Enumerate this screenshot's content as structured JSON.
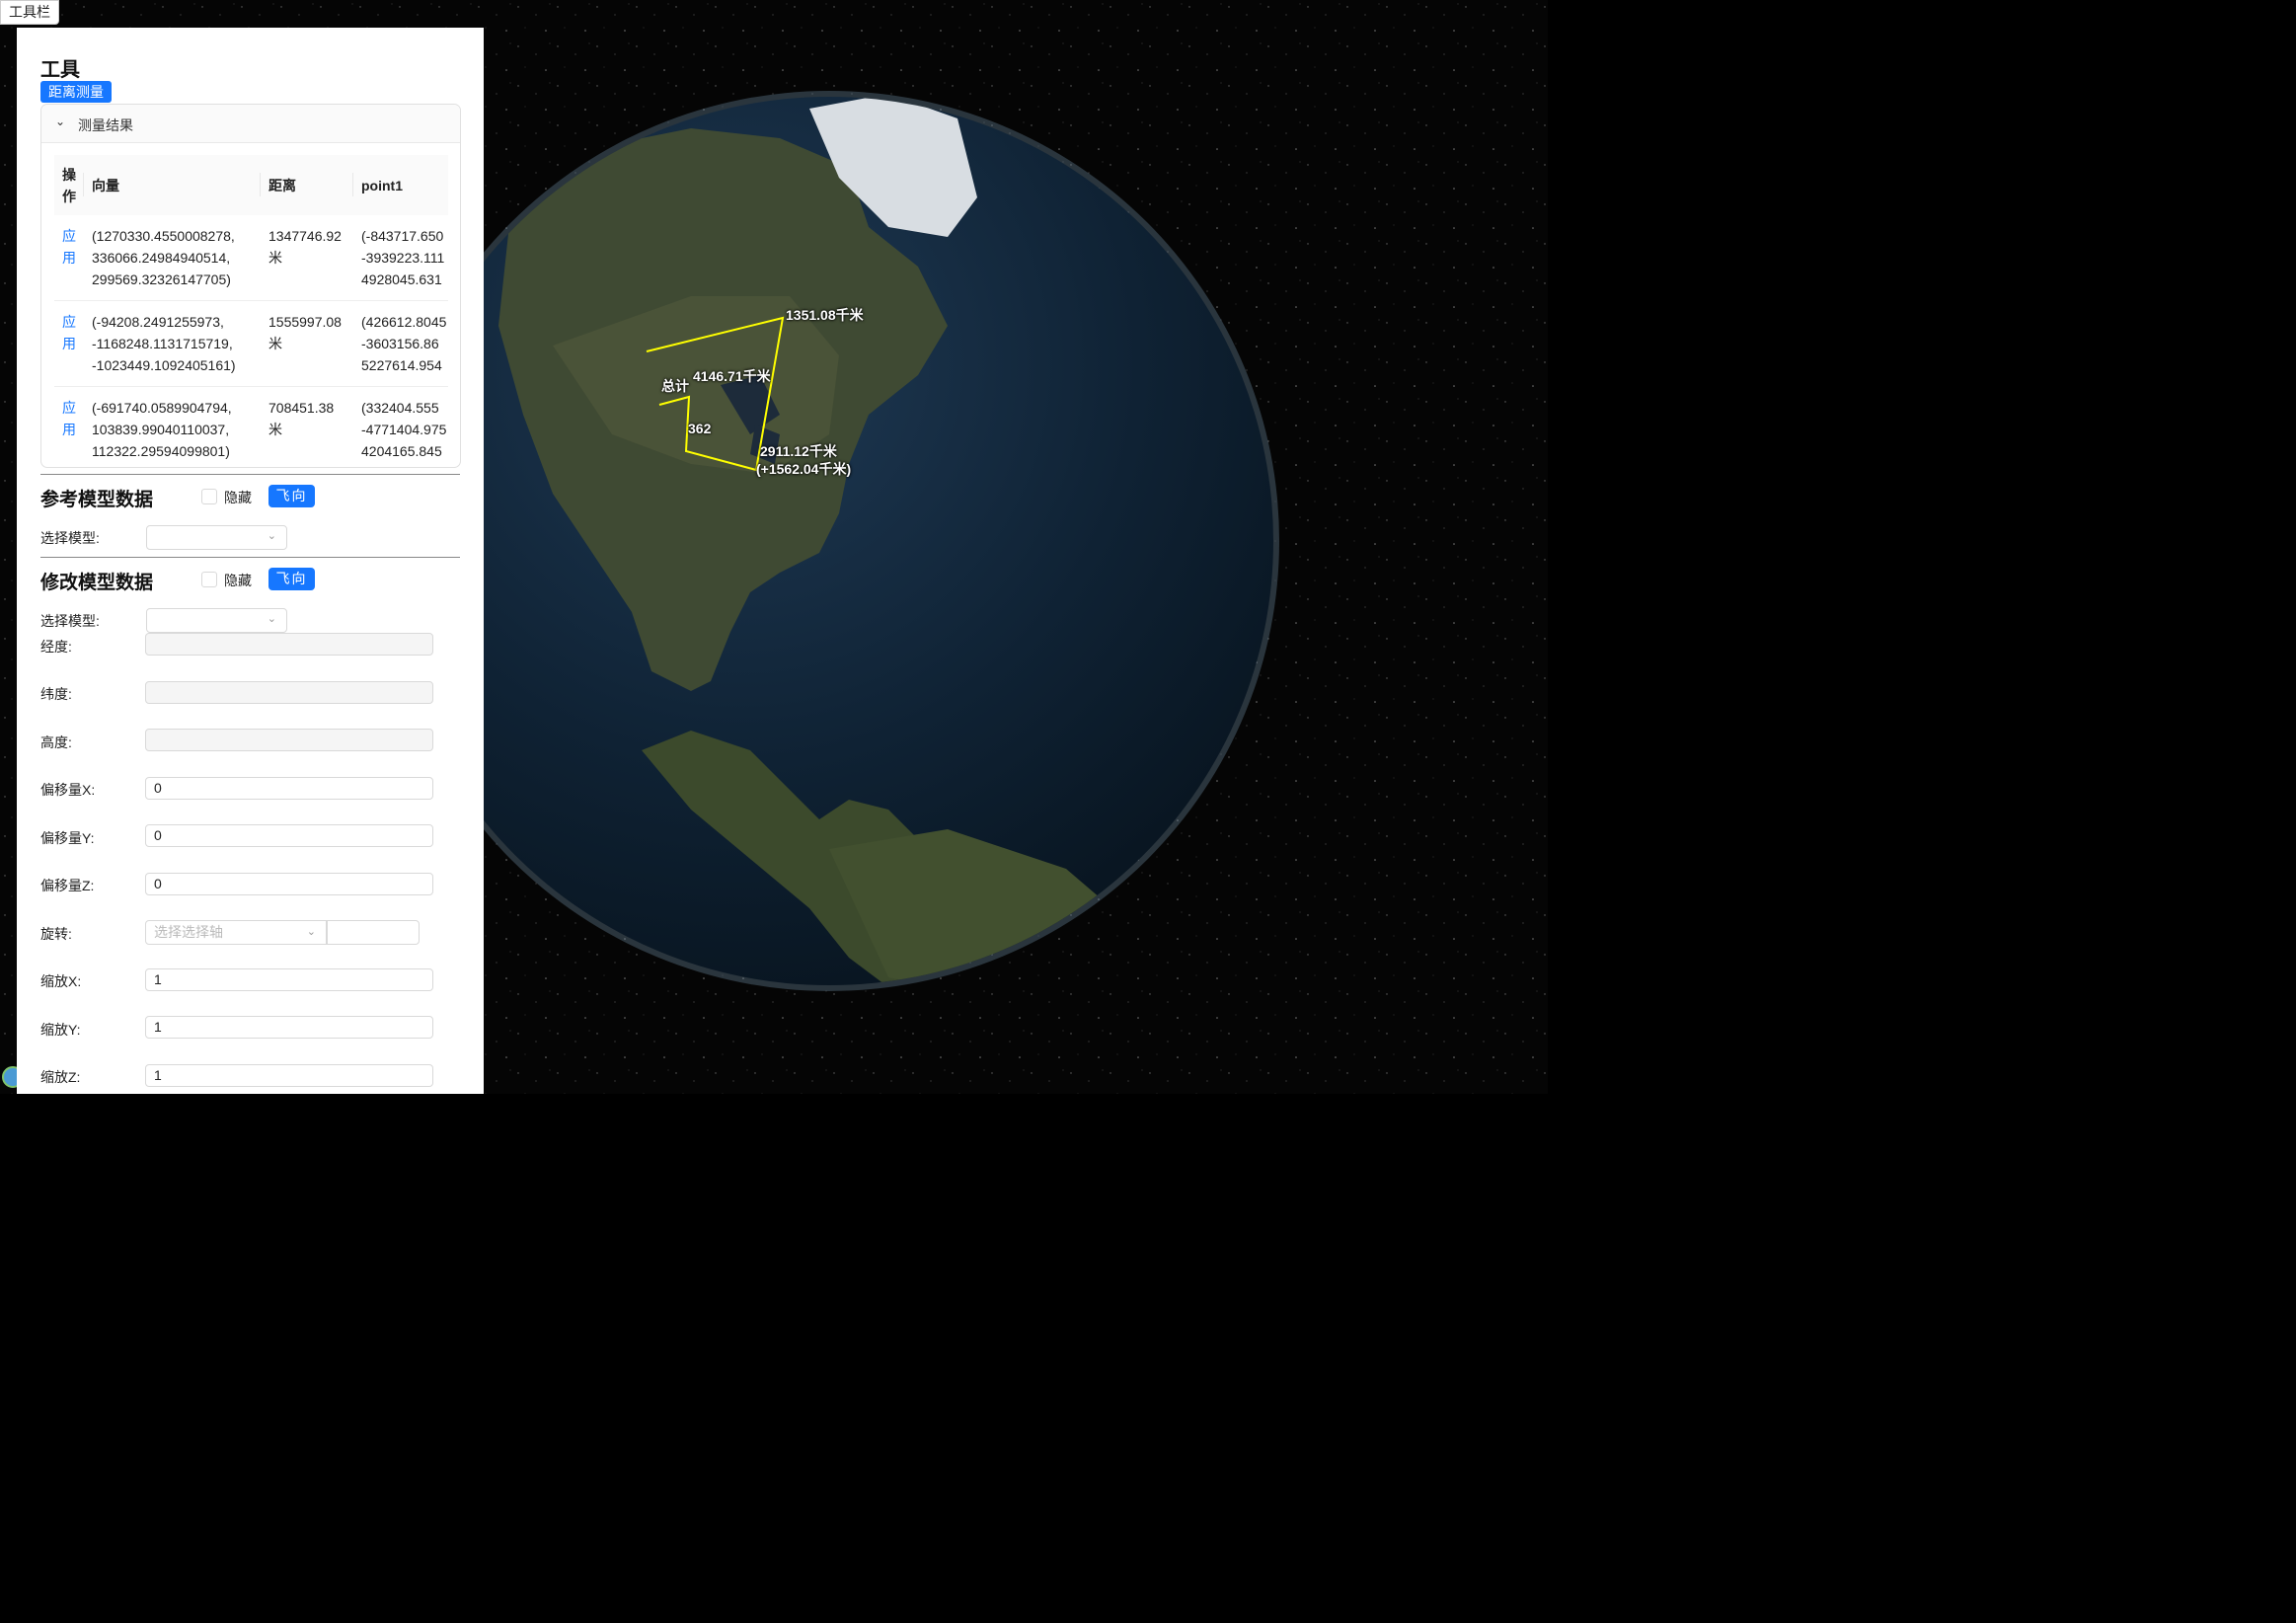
{
  "toolbar": {
    "label": "工具栏"
  },
  "panel": {
    "title": "工具",
    "measure_button": "距离测量",
    "collapse": {
      "title": "测量结果",
      "columns": [
        "操作",
        "向量",
        "距离",
        "point1"
      ],
      "rows": [
        {
          "action": "应用",
          "vector": [
            "(1270330.4550008278,",
            "336066.24984940514,",
            "299569.32326147705)"
          ],
          "distance": "1347746.92米",
          "point1": [
            "(-843717.650",
            "-3939223.111",
            "4928045.631"
          ]
        },
        {
          "action": "应用",
          "vector": [
            "(-94208.2491255973,",
            "-1168248.1131715719,",
            "-1023449.1092405161)"
          ],
          "distance": "1555997.08米",
          "point1": [
            "(426612.8045",
            "-3603156.86",
            "5227614.954"
          ]
        },
        {
          "action": "应用",
          "vector": [
            "(-691740.0589904794,",
            "103839.99040110037,",
            "112322.29594099801)"
          ],
          "distance": "708451.38米",
          "point1": [
            "(332404.555",
            "-4771404.975",
            "4204165.845"
          ]
        }
      ]
    },
    "reference": {
      "title": "参考模型数据",
      "hide_label": "隐藏",
      "fly_button": "飞向",
      "select_label": "选择模型:"
    },
    "modify": {
      "title": "修改模型数据",
      "hide_label": "隐藏",
      "fly_button": "飞向",
      "select_label": "选择模型:",
      "fields": {
        "longitude": {
          "label": "经度:",
          "value": ""
        },
        "latitude": {
          "label": "纬度:",
          "value": ""
        },
        "height": {
          "label": "高度:",
          "value": ""
        },
        "offset_x": {
          "label": "偏移量X:",
          "value": "0"
        },
        "offset_y": {
          "label": "偏移量Y:",
          "value": "0"
        },
        "offset_z": {
          "label": "偏移量Z:",
          "value": "0"
        },
        "rotation": {
          "label": "旋转:",
          "placeholder": "选择选择轴"
        },
        "scale_x": {
          "label": "缩放X:",
          "value": "1"
        },
        "scale_y": {
          "label": "缩放Y:",
          "value": "1"
        },
        "scale_z": {
          "label": "缩放Z:",
          "value": "1"
        }
      }
    }
  },
  "globe": {
    "labels": [
      "1351.08千米",
      "4146.71千米",
      "总计",
      "362",
      "2911.12千米",
      "(+1562.04千米)"
    ],
    "line_color": "#ffff00"
  }
}
